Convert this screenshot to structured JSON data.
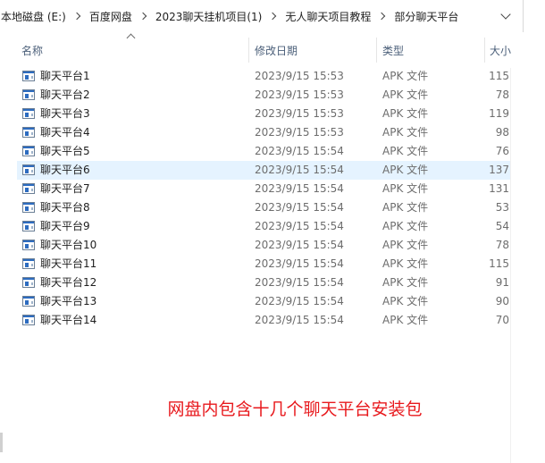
{
  "breadcrumbs": [
    "本地磁盘 (E:)",
    "百度网盘",
    "2023聊天挂机项目(1)",
    "无人聊天项目教程",
    "部分聊天平台"
  ],
  "columns": {
    "name": "名称",
    "date": "修改日期",
    "type": "类型",
    "size": "大小"
  },
  "files": [
    {
      "name": "聊天平台1",
      "date": "2023/9/15 15:53",
      "type": "APK 文件",
      "size": "115"
    },
    {
      "name": "聊天平台2",
      "date": "2023/9/15 15:53",
      "type": "APK 文件",
      "size": "78"
    },
    {
      "name": "聊天平台3",
      "date": "2023/9/15 15:53",
      "type": "APK 文件",
      "size": "119"
    },
    {
      "name": "聊天平台4",
      "date": "2023/9/15 15:53",
      "type": "APK 文件",
      "size": "98"
    },
    {
      "name": "聊天平台5",
      "date": "2023/9/15 15:54",
      "type": "APK 文件",
      "size": "76"
    },
    {
      "name": "聊天平台6",
      "date": "2023/9/15 15:54",
      "type": "APK 文件",
      "size": "137",
      "selected": true
    },
    {
      "name": "聊天平台7",
      "date": "2023/9/15 15:54",
      "type": "APK 文件",
      "size": "131"
    },
    {
      "name": "聊天平台8",
      "date": "2023/9/15 15:54",
      "type": "APK 文件",
      "size": "53"
    },
    {
      "name": "聊天平台9",
      "date": "2023/9/15 15:54",
      "type": "APK 文件",
      "size": "54"
    },
    {
      "name": "聊天平台10",
      "date": "2023/9/15 15:54",
      "type": "APK 文件",
      "size": "78"
    },
    {
      "name": "聊天平台11",
      "date": "2023/9/15 15:54",
      "type": "APK 文件",
      "size": "115"
    },
    {
      "name": "聊天平台12",
      "date": "2023/9/15 15:54",
      "type": "APK 文件",
      "size": "91"
    },
    {
      "name": "聊天平台13",
      "date": "2023/9/15 15:54",
      "type": "APK 文件",
      "size": "90"
    },
    {
      "name": "聊天平台14",
      "date": "2023/9/15 15:54",
      "type": "APK 文件",
      "size": "70"
    }
  ],
  "caption": "网盘内包含十几个聊天平台安装包",
  "icons": {
    "file": "apk-file-icon",
    "separator": "chevron-right-icon",
    "dropdown": "chevron-down-icon",
    "sort": "sort-ascending-icon"
  },
  "colors": {
    "selection": "#e5f3ff",
    "caption": "#e8191d",
    "header_text": "#4c607a"
  }
}
